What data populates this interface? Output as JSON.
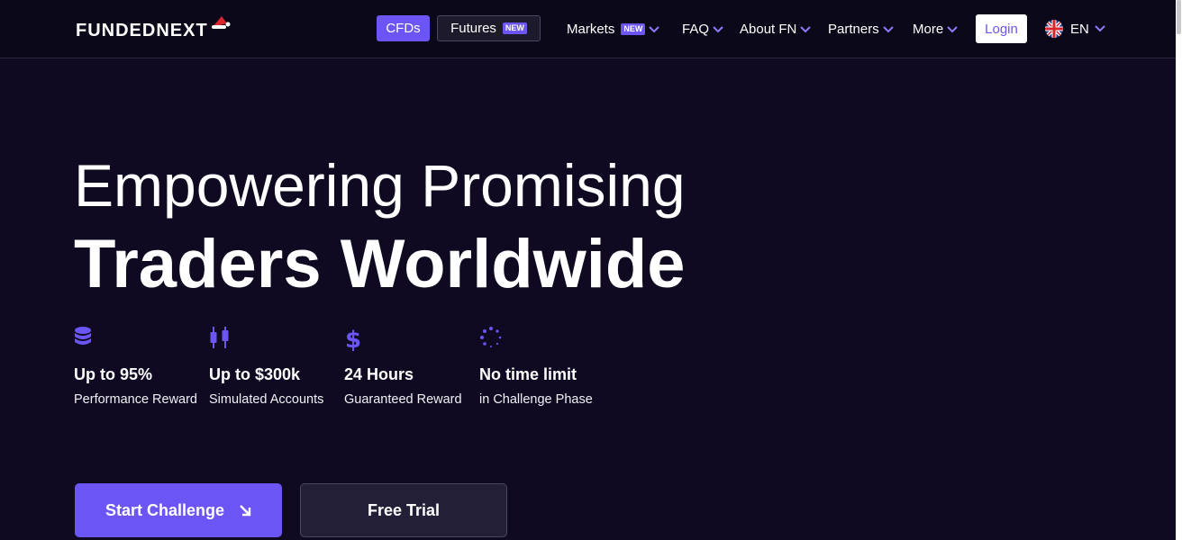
{
  "header": {
    "logo_text": "FUNDEDNEXT",
    "cfds_label": "CFDs",
    "futures_label": "Futures",
    "futures_badge": "NEW",
    "nav": {
      "markets": "Markets",
      "markets_badge": "NEW",
      "faq": "FAQ",
      "about": "About FN",
      "partners": "Partners",
      "more": "More"
    },
    "login_label": "Login",
    "language": "EN"
  },
  "hero": {
    "line1": "Empowering Promising",
    "line2": "Traders Worldwide"
  },
  "features": [
    {
      "icon": "coins-stack-icon",
      "title": "Up to 95%",
      "subtitle": "Performance Reward"
    },
    {
      "icon": "candlestick-icon",
      "title": "Up to $300k",
      "subtitle": "Simulated Accounts"
    },
    {
      "icon": "dollar-icon",
      "title": "24 Hours",
      "subtitle": "Guaranteed Reward"
    },
    {
      "icon": "loader-icon",
      "title": "No time limit",
      "subtitle": "in Challenge Phase"
    }
  ],
  "cta": {
    "start_label": "Start Challenge",
    "trial_label": "Free Trial"
  },
  "colors": {
    "accent": "#6b56f5",
    "background": "#0f0a22",
    "header_background": "#0b0819"
  }
}
